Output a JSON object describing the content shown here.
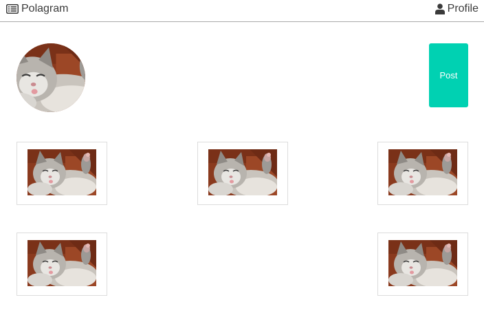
{
  "header": {
    "brand_label": "Polagram",
    "brand_icon": "list-icon",
    "profile_label": "Profile",
    "profile_icon": "user-icon"
  },
  "actions": {
    "post_label": "Post"
  },
  "colors": {
    "accent": "#00d1b2",
    "divider": "#a9a9a9",
    "tile_border": "#dcdcdc"
  },
  "feed": {
    "items": [
      {
        "alt": "kitten photo"
      },
      {
        "alt": "kitten photo"
      },
      {
        "alt": "kitten photo"
      },
      {
        "alt": "kitten photo"
      },
      {
        "alt": "kitten photo"
      }
    ]
  }
}
